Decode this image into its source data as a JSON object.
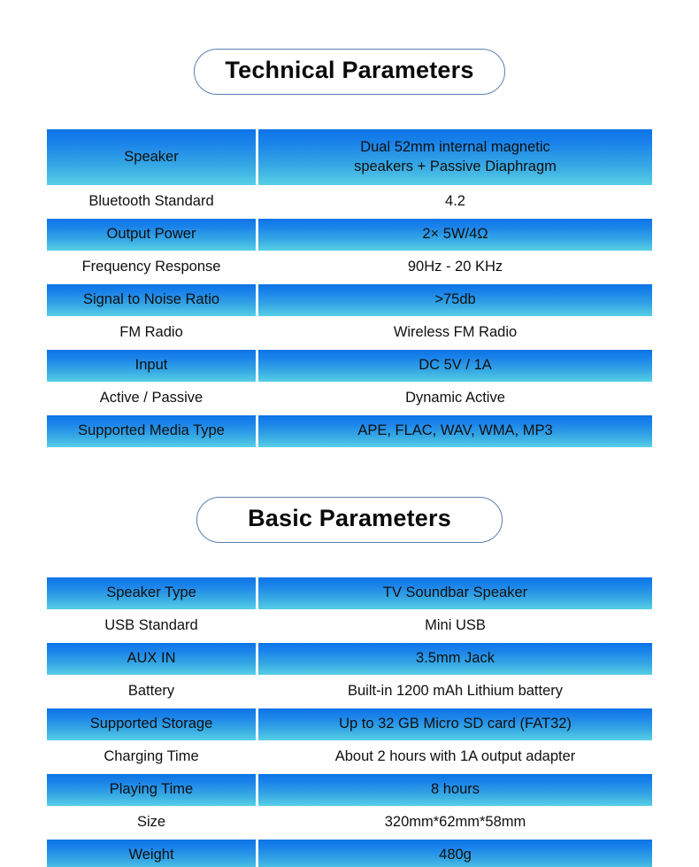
{
  "sections": [
    {
      "title": "Technical Parameters",
      "rows": [
        {
          "label": "Speaker",
          "value": "Dual 52mm internal magnetic\nspeakers + Passive Diaphragm",
          "banded": true,
          "tall": true
        },
        {
          "label": "Bluetooth Standard",
          "value": "4.2",
          "banded": false,
          "tall": false
        },
        {
          "label": "Output Power",
          "value": "2× 5W/4Ω",
          "banded": true,
          "tall": false
        },
        {
          "label": "Frequency Response",
          "value": "90Hz - 20 KHz",
          "banded": false,
          "tall": false
        },
        {
          "label": "Signal to Noise Ratio",
          "value": ">75db",
          "banded": true,
          "tall": false
        },
        {
          "label": "FM Radio",
          "value": "Wireless FM Radio",
          "banded": false,
          "tall": false
        },
        {
          "label": "Input",
          "value": "DC 5V / 1A",
          "banded": true,
          "tall": false
        },
        {
          "label": "Active / Passive",
          "value": "Dynamic Active",
          "banded": false,
          "tall": false
        },
        {
          "label": "Supported Media Type",
          "value": "APE, FLAC, WAV, WMA, MP3",
          "banded": true,
          "tall": false
        }
      ]
    },
    {
      "title": "Basic Parameters",
      "rows": [
        {
          "label": "Speaker Type",
          "value": "TV Soundbar Speaker",
          "banded": true,
          "tall": false
        },
        {
          "label": "USB Standard",
          "value": "Mini USB",
          "banded": false,
          "tall": false
        },
        {
          "label": "AUX IN",
          "value": "3.5mm Jack",
          "banded": true,
          "tall": false
        },
        {
          "label": "Battery",
          "value": "Built-in 1200 mAh Lithium battery",
          "banded": false,
          "tall": false
        },
        {
          "label": "Supported Storage",
          "value": "Up to 32 GB Micro SD card (FAT32)",
          "banded": true,
          "tall": false
        },
        {
          "label": "Charging Time",
          "value": "About 2 hours with 1A output adapter",
          "banded": false,
          "tall": false
        },
        {
          "label": "Playing Time",
          "value": "8 hours",
          "banded": true,
          "tall": false
        },
        {
          "label": "Size",
          "value": "320mm*62mm*58mm",
          "banded": false,
          "tall": false
        },
        {
          "label": "Weight",
          "value": "480g",
          "banded": true,
          "tall": false
        }
      ]
    }
  ],
  "colors": {
    "band_top": "#0d74e6",
    "band_bottom": "#58cfe6",
    "pill_border": "#5b7fb0",
    "text": "#101010",
    "background": "#ffffff"
  }
}
